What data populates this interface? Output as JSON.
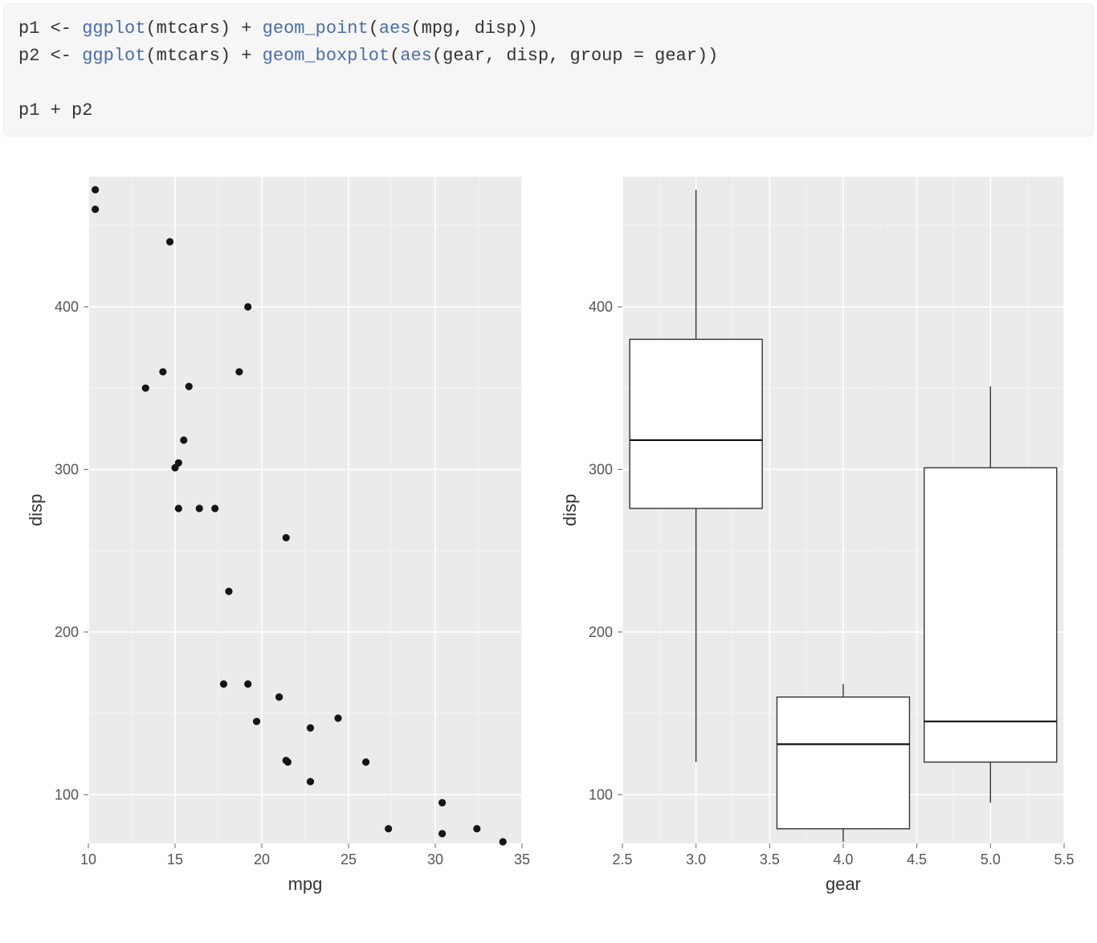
{
  "code": {
    "line1_pre": "p1 <- ",
    "fn_ggplot": "ggplot",
    "line1_mid": "(mtcars) + ",
    "fn_point": "geom_point",
    "line1_args": "(",
    "fn_aes": "aes",
    "line1_end": "(mpg, disp))",
    "line2_pre": "p2 <- ",
    "line2_mid": "(mtcars) + ",
    "fn_box": "geom_boxplot",
    "line2_end": "(gear, disp, group = gear))",
    "line3": "p1 + p2"
  },
  "chart_data": [
    {
      "type": "scatter",
      "xlabel": "mpg",
      "ylabel": "disp",
      "xlim": [
        10,
        35
      ],
      "ylim": [
        70,
        480
      ],
      "x_ticks": [
        10,
        15,
        20,
        25,
        30,
        35
      ],
      "y_ticks": [
        100,
        200,
        300,
        400
      ],
      "data": [
        {
          "x": 21.0,
          "y": 160
        },
        {
          "x": 21.0,
          "y": 160
        },
        {
          "x": 22.8,
          "y": 108
        },
        {
          "x": 21.4,
          "y": 258
        },
        {
          "x": 18.7,
          "y": 360
        },
        {
          "x": 18.1,
          "y": 225
        },
        {
          "x": 14.3,
          "y": 360
        },
        {
          "x": 24.4,
          "y": 147
        },
        {
          "x": 22.8,
          "y": 141
        },
        {
          "x": 19.2,
          "y": 168
        },
        {
          "x": 17.8,
          "y": 168
        },
        {
          "x": 16.4,
          "y": 276
        },
        {
          "x": 17.3,
          "y": 276
        },
        {
          "x": 15.2,
          "y": 276
        },
        {
          "x": 10.4,
          "y": 472
        },
        {
          "x": 10.4,
          "y": 460
        },
        {
          "x": 14.7,
          "y": 440
        },
        {
          "x": 32.4,
          "y": 79
        },
        {
          "x": 30.4,
          "y": 76
        },
        {
          "x": 33.9,
          "y": 71
        },
        {
          "x": 21.5,
          "y": 120
        },
        {
          "x": 15.5,
          "y": 318
        },
        {
          "x": 15.2,
          "y": 304
        },
        {
          "x": 13.3,
          "y": 350
        },
        {
          "x": 19.2,
          "y": 400
        },
        {
          "x": 27.3,
          "y": 79
        },
        {
          "x": 26.0,
          "y": 120
        },
        {
          "x": 30.4,
          "y": 95
        },
        {
          "x": 15.8,
          "y": 351
        },
        {
          "x": 19.7,
          "y": 145
        },
        {
          "x": 15.0,
          "y": 301
        },
        {
          "x": 21.4,
          "y": 121
        }
      ]
    },
    {
      "type": "boxplot",
      "xlabel": "gear",
      "ylabel": "disp",
      "xlim": [
        2.5,
        5.5
      ],
      "ylim": [
        70,
        480
      ],
      "x_ticks": [
        2.5,
        3.0,
        3.5,
        4.0,
        4.5,
        5.0,
        5.5
      ],
      "y_ticks": [
        100,
        200,
        300,
        400
      ],
      "x_tick_labels": [
        "2.5",
        "3.0",
        "3.5",
        "4.0",
        "4.5",
        "5.0",
        "5.5"
      ],
      "boxes": [
        {
          "x": 3,
          "min": 120,
          "q1": 276,
          "median": 318,
          "q3": 380,
          "max": 472
        },
        {
          "x": 4,
          "min": 71,
          "q1": 79,
          "median": 131,
          "q3": 160,
          "max": 168
        },
        {
          "x": 5,
          "min": 95,
          "q1": 120,
          "median": 145,
          "q3": 301,
          "max": 351
        }
      ]
    }
  ]
}
